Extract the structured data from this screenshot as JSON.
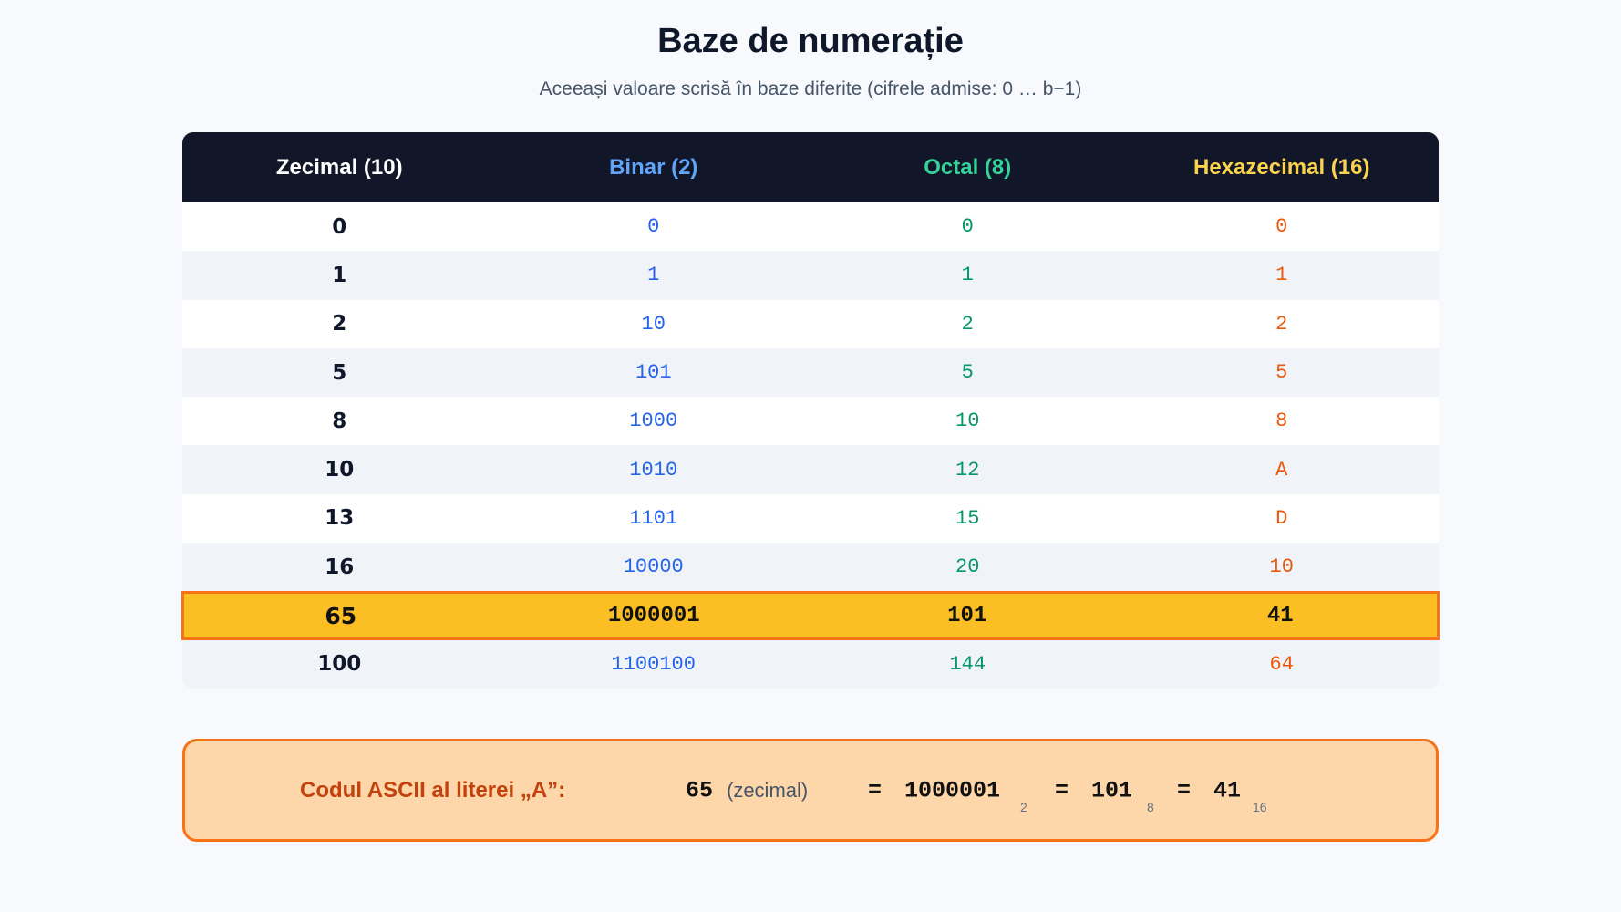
{
  "title": "Baze de numerație",
  "subtitle": "Aceeași valoare scrisă în baze diferite (cifrele admise: 0 … b−1)",
  "colors": {
    "header_bg": "#111729",
    "decimal": "#ffffff",
    "binary": "#60a5fa",
    "octal": "#34d399",
    "hex": "#fcd34d",
    "binary_cell": "#2563eb",
    "octal_cell": "#059669",
    "hex_cell": "#ea580c",
    "highlight_bg": "#fbbf24",
    "highlight_border": "#f97316"
  },
  "table": {
    "headers": [
      "Zecimal (10)",
      "Binar (2)",
      "Octal (8)",
      "Hexazecimal (16)"
    ],
    "rows": [
      [
        "0",
        "0",
        "0",
        "0"
      ],
      [
        "1",
        "1",
        "1",
        "1"
      ],
      [
        "2",
        "10",
        "2",
        "2"
      ],
      [
        "5",
        "101",
        "5",
        "5"
      ],
      [
        "8",
        "1000",
        "10",
        "8"
      ],
      [
        "10",
        "1010",
        "12",
        "A"
      ],
      [
        "13",
        "1101",
        "15",
        "D"
      ],
      [
        "16",
        "10000",
        "20",
        "10"
      ],
      [
        "65",
        "1000001",
        "101",
        "41"
      ],
      [
        "100",
        "1100100",
        "144",
        "64"
      ]
    ],
    "highlighted_row": 8
  },
  "ascii": {
    "label": "Codul ASCII al literei „A”:",
    "decimal_value": "65",
    "decimal_note": "(zecimal)",
    "equals": "=",
    "binary_value": "1000001",
    "binary_base": "2",
    "octal_value": "101",
    "octal_base": "8",
    "hex_value": "41",
    "hex_base": "16"
  }
}
